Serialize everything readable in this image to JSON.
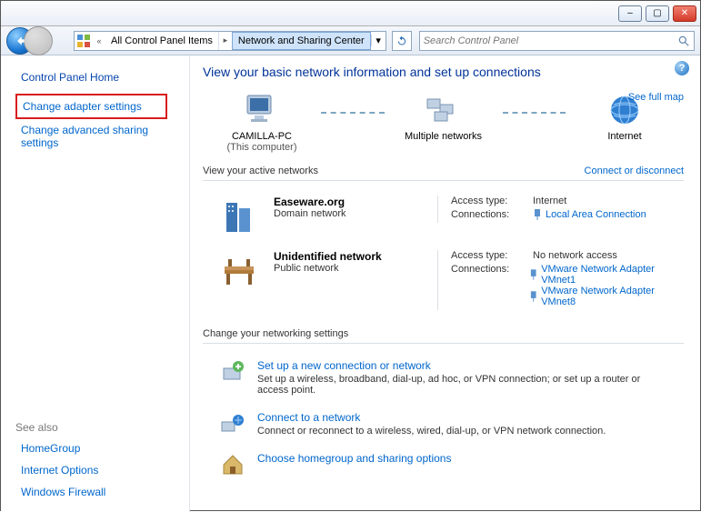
{
  "window": {
    "minimize": "–",
    "maximize": "▢",
    "close": "✕"
  },
  "breadcrumb": {
    "prefix": "«",
    "items": [
      "All Control Panel Items",
      "Network and Sharing Center"
    ]
  },
  "search": {
    "placeholder": "Search Control Panel"
  },
  "sidebar": {
    "home": "Control Panel Home",
    "links": [
      "Change adapter settings",
      "Change advanced sharing settings"
    ],
    "seealso_header": "See also",
    "seealso": [
      "HomeGroup",
      "Internet Options",
      "Windows Firewall"
    ]
  },
  "page": {
    "title": "View your basic network information and set up connections",
    "fullmap": "See full map",
    "nodes": [
      {
        "label": "CAMILLA-PC",
        "sub": "(This computer)"
      },
      {
        "label": "Multiple networks",
        "sub": ""
      },
      {
        "label": "Internet",
        "sub": ""
      }
    ],
    "active_header": "View your active networks",
    "connect_link": "Connect or disconnect",
    "networks": [
      {
        "name": "Easeware.org",
        "type": "Domain network",
        "access": "Internet",
        "connections": [
          "Local Area Connection"
        ]
      },
      {
        "name": "Unidentified network",
        "type": "Public network",
        "access": "No network access",
        "connections": [
          "VMware Network Adapter VMnet1",
          "VMware Network Adapter VMnet8"
        ]
      }
    ],
    "labels": {
      "access": "Access type:",
      "connections": "Connections:"
    },
    "settings_header": "Change your networking settings",
    "settings": [
      {
        "title": "Set up a new connection or network",
        "desc": "Set up a wireless, broadband, dial-up, ad hoc, or VPN connection; or set up a router or access point."
      },
      {
        "title": "Connect to a network",
        "desc": "Connect or reconnect to a wireless, wired, dial-up, or VPN network connection."
      },
      {
        "title": "Choose homegroup and sharing options",
        "desc": ""
      }
    ]
  }
}
